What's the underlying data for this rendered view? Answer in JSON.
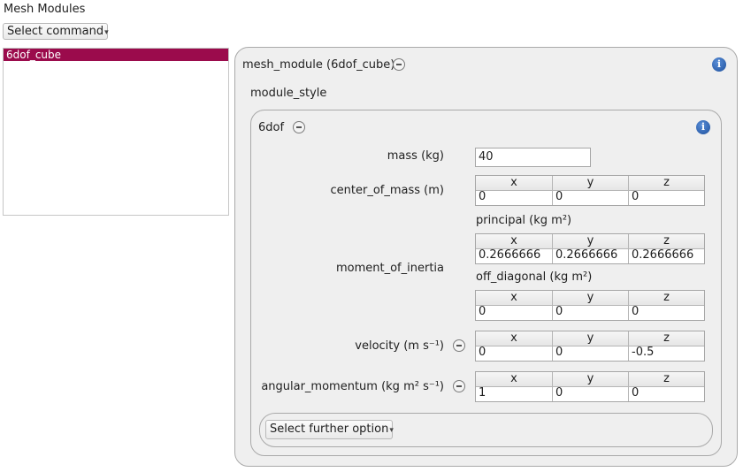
{
  "header": {
    "title": "Mesh Modules",
    "command_label": "Select command"
  },
  "modules": [
    {
      "name": "6dof_cube",
      "selected": true
    }
  ],
  "mesh_module": {
    "title": "mesh_module (6dof_cube)",
    "section_label": "module_style",
    "style": {
      "title": "6dof",
      "mass": {
        "label": "mass (kg)",
        "value": "40"
      },
      "center_of_mass": {
        "label": "center_of_mass (m)",
        "headers": [
          "x",
          "y",
          "z"
        ],
        "values": [
          "0",
          "0",
          "0"
        ]
      },
      "moment_of_inertia": {
        "label": "moment_of_inertia",
        "principal": {
          "label": "principal (kg m²)",
          "headers": [
            "x",
            "y",
            "z"
          ],
          "values": [
            "0.2666666",
            "0.2666666",
            "0.2666666"
          ]
        },
        "off_diagonal": {
          "label": "off_diagonal (kg m²)",
          "headers": [
            "x",
            "y",
            "z"
          ],
          "values": [
            "0",
            "0",
            "0"
          ]
        }
      },
      "velocity": {
        "label": "velocity (m s⁻¹)",
        "headers": [
          "x",
          "y",
          "z"
        ],
        "values": [
          "0",
          "0",
          "-0.5"
        ]
      },
      "angular_momentum": {
        "label": "angular_momentum (kg m² s⁻¹)",
        "headers": [
          "x",
          "y",
          "z"
        ],
        "values": [
          "1",
          "0",
          "0"
        ]
      },
      "further_option_label": "Select further option"
    }
  },
  "icons": {
    "collapse": "minus-circle-icon",
    "info": "info-icon",
    "dropdown": "caret-down-icon"
  },
  "colors": {
    "selection": "#9b0b4c",
    "panel": "#efefef",
    "info": "#1d4f9c"
  }
}
